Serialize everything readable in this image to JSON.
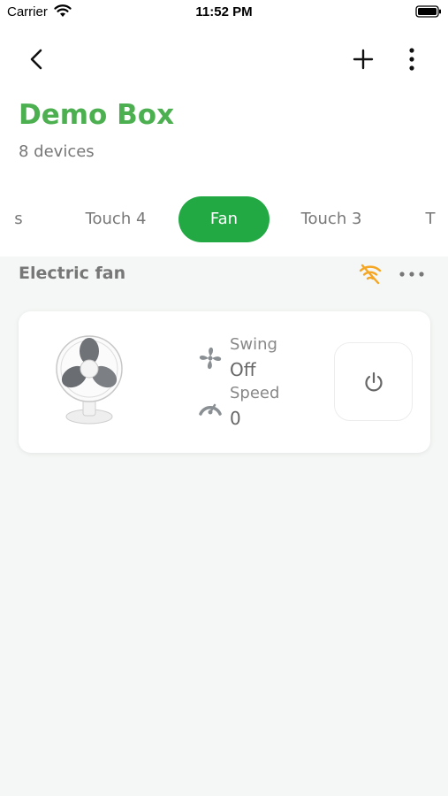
{
  "status_bar": {
    "carrier": "Carrier",
    "time": "11:52 PM"
  },
  "header": {
    "title": "Demo Box",
    "subtitle": "8 devices"
  },
  "tabs": [
    {
      "label": "s",
      "active": false
    },
    {
      "label": "Touch 4",
      "active": false
    },
    {
      "label": "Fan",
      "active": true
    },
    {
      "label": "Touch 3",
      "active": false
    },
    {
      "label": "T",
      "active": false
    }
  ],
  "section": {
    "title": "Electric fan"
  },
  "device": {
    "properties": [
      {
        "icon": "fan-icon",
        "label": "Swing",
        "value": "Off"
      },
      {
        "icon": "speedometer-icon",
        "label": "Speed",
        "value": "0"
      }
    ]
  },
  "colors": {
    "accent": "#4caf50",
    "active_tab": "#22a943",
    "warning": "#f5a623",
    "background": "#f5f7f6"
  }
}
